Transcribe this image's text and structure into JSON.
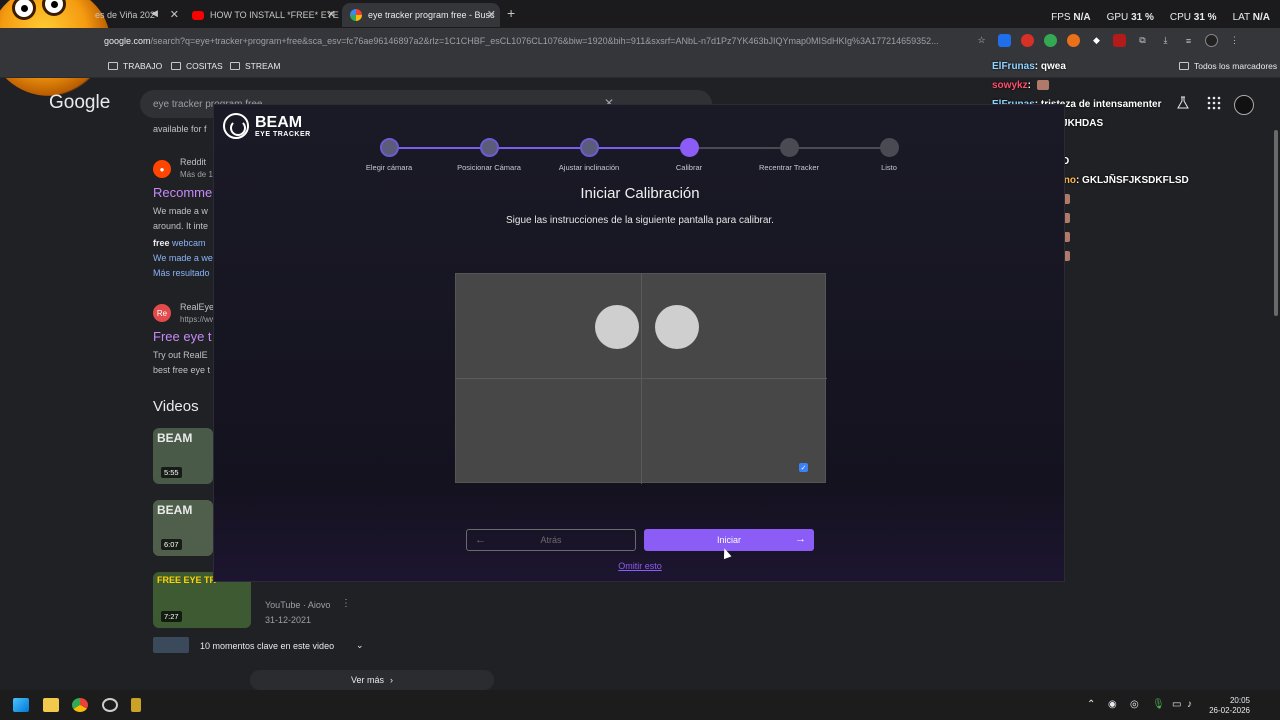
{
  "browser": {
    "tabs": [
      {
        "title": "es de Viña 202"
      },
      {
        "title": "HOW TO INSTALL *FREE* EYE T"
      },
      {
        "title": "eye tracker program free - Busc"
      }
    ],
    "url_prefix": "google.com",
    "url_rest": "/search?q=eye+tracker+program+free&sca_esv=fc76ae96146897a2&rlz=1C1CHBF_esCL1076CL1076&biw=1920&bih=911&sxsrf=ANbL-n7d1Pz7YK463bJIQYmap0MISdHKIg%3A177214659352...",
    "bookmarks": [
      "TRABAJO",
      "COSITAS",
      "STREAM"
    ],
    "all_bookmarks": "Todos los marcadores"
  },
  "overlay": {
    "fps_label": "FPS",
    "fps_value": "N/A",
    "gpu_label": "GPU",
    "gpu_value": "31 %",
    "cpu_label": "CPU",
    "cpu_value": "31 %",
    "lat_label": "LAT",
    "lat_value": "N/A"
  },
  "google": {
    "logo": "Google",
    "query": "eye tracker program free",
    "results": {
      "r0_snip": "available for f",
      "r1_site": "Reddit",
      "r1_site_sub": "Más de 1",
      "r1_title": "Recomme",
      "r1_snip1": "We made a w",
      "r1_snip2": "around. It inte",
      "r1_snip3a": "free",
      "r1_snip3b": " webcam",
      "r1_snip4": "We made a we",
      "r1_more": "Más resultado",
      "r2_site": "RealEye",
      "r2_url": "https://ww",
      "r2_title": "Free eye t",
      "r2_snip1": "Try out RealE",
      "r2_snip2": "best free eye t"
    },
    "videos_heading": "Videos",
    "videos": [
      {
        "duration": "5:55",
        "thumb": "BEAM"
      },
      {
        "duration": "6:07",
        "thumb": "BEAM"
      },
      {
        "duration": "7:27",
        "thumb": "FREE EYE TR"
      }
    ],
    "video3_source": "YouTube · Aiovo",
    "video3_date": "31-12-2021",
    "moments": "10 momentos clave en este video",
    "see_more": "Ver más"
  },
  "beam": {
    "logo_title": "BEAM",
    "logo_sub": "EYE TRACKER",
    "steps": [
      "Elegir cámara",
      "Posicionar Cámara",
      "Ajustar inclinación",
      "Calibrar",
      "Recentrar Tracker",
      "Listo"
    ],
    "title": "Iniciar Calibración",
    "subtitle": "Sigue las instrucciones de la siguiente pantalla para calibrar.",
    "back_label": "Atrás",
    "start_label": "Iniciar",
    "skip_label": "Omitir esto",
    "accent": "#8b5cf6"
  },
  "chat": [
    {
      "user": "ElFrunas",
      "msg": "qwea",
      "color": "#8fd3ff"
    },
    {
      "user": "sowykz",
      "msg": "",
      "color": "#ff4d6d"
    },
    {
      "user": "ElFrunas",
      "msg": "tristeza de intensamenter",
      "color": "#8fd3ff"
    },
    {
      "user": "ElFrunas",
      "msg": "DASJKHDAS",
      "color": "#8fd3ff"
    },
    {
      "user": "ElFrunas",
      "msg": "",
      "color": "#8fd3ff"
    },
    {
      "user": "sowykz",
      "msg": "XDDDD",
      "color": "#ff4d6d"
    },
    {
      "user": "Glammamericano",
      "msg": "GKLJÑSFJKSDKFLSD",
      "color": "#ffb84d"
    },
    {
      "user": "Salazar4200",
      "msg": "",
      "color": "#ff6a8a"
    },
    {
      "user": "Salazar4200",
      "msg": "",
      "color": "#ff6a8a"
    },
    {
      "user": "Salazar4200",
      "msg": "",
      "color": "#ff6a8a"
    },
    {
      "user": "Salazar4200",
      "msg": "",
      "color": "#ff6a8a"
    }
  ],
  "taskbar": {
    "time": "20:05",
    "date": "26-02-2026"
  }
}
